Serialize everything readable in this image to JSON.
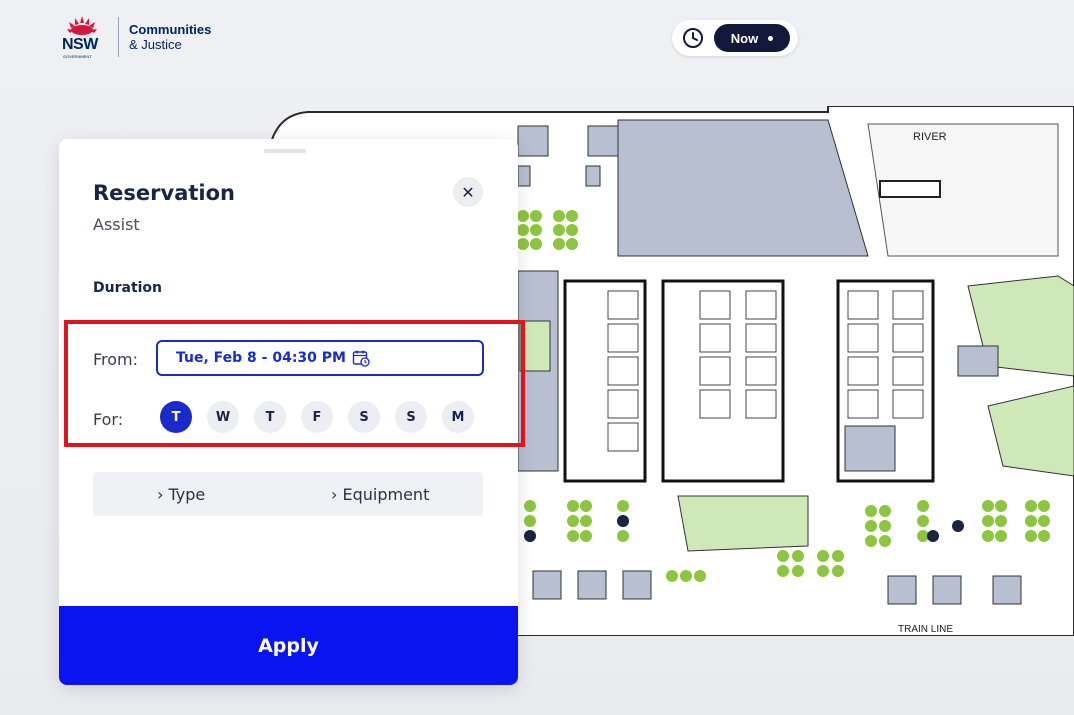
{
  "brand": {
    "short": "NSW",
    "gov": "GOVERNMENT",
    "line1": "Communities",
    "line2": "& Justice",
    "accent": "#d7153a"
  },
  "time_selector": {
    "icon": "clock-icon",
    "label": "Now"
  },
  "map": {
    "label_top": "RIVER",
    "label_bottom": "TRAIN LINE"
  },
  "panel": {
    "title": "Reservation",
    "subtitle": "Assist",
    "close_icon": "close-icon",
    "duration_label": "Duration",
    "from_label": "From:",
    "from_value": "Tue, Feb 8 - 04:30 PM",
    "for_label": "For:",
    "days": [
      "T",
      "W",
      "T",
      "F",
      "S",
      "S",
      "M"
    ],
    "active_day_index": 0,
    "filters": {
      "type_label": "› Type",
      "equipment_label": "› Equipment"
    },
    "apply_label": "Apply"
  },
  "colors": {
    "primary": "#0a14f0",
    "navy": "#14183a",
    "highlight": "#e2131b",
    "desk_green": "#8cc63f",
    "room_green": "#cfe8b8",
    "zone_blue": "#aab4ca"
  }
}
